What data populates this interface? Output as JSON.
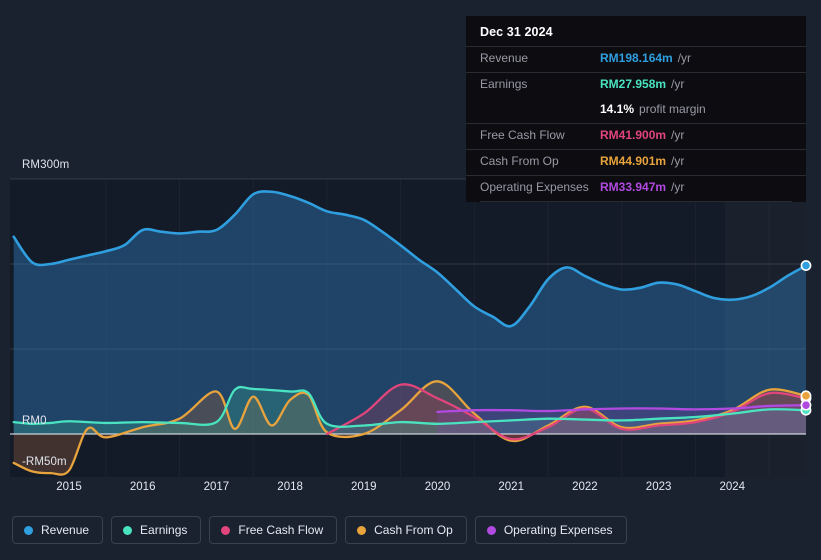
{
  "axis": {
    "y_labels": [
      {
        "text": "RM300m",
        "value": 300
      },
      {
        "text": "RM0",
        "value": 0
      },
      {
        "text": "-RM50m",
        "value": -50
      }
    ],
    "x_labels": [
      "2015",
      "2016",
      "2017",
      "2018",
      "2019",
      "2020",
      "2021",
      "2022",
      "2023",
      "2024"
    ],
    "currency": "RM",
    "unit": "m"
  },
  "tooltip": {
    "date": "Dec 31 2024",
    "rows": [
      {
        "label": "Revenue",
        "value": "RM198.164m",
        "unit": "/yr",
        "color": "#2f9fe0"
      },
      {
        "label": "Earnings",
        "value": "RM27.958m",
        "unit": "/yr",
        "color": "#4ae3c0"
      },
      {
        "label": "",
        "value": "14.1%",
        "unit": "profit margin",
        "color": "#ffffff"
      },
      {
        "label": "Free Cash Flow",
        "value": "RM41.900m",
        "unit": "/yr",
        "color": "#e0457b"
      },
      {
        "label": "Cash From Op",
        "value": "RM44.901m",
        "unit": "/yr",
        "color": "#e8a33d"
      },
      {
        "label": "Operating Expenses",
        "value": "RM33.947m",
        "unit": "/yr",
        "color": "#b14ae0"
      }
    ]
  },
  "legend": {
    "items": [
      {
        "label": "Revenue",
        "color": "#2f9fe0"
      },
      {
        "label": "Earnings",
        "color": "#4ae3c0"
      },
      {
        "label": "Free Cash Flow",
        "color": "#e0457b"
      },
      {
        "label": "Cash From Op",
        "color": "#e8a33d"
      },
      {
        "label": "Operating Expenses",
        "color": "#b14ae0"
      }
    ]
  },
  "chart_data": {
    "type": "area",
    "title": "",
    "xlabel": "",
    "ylabel": "RM",
    "ylim": [
      -50,
      300
    ],
    "xlim": [
      2014.2,
      2025.0
    ],
    "grid": true,
    "legend_position": "bottom",
    "gridlines": [
      300,
      200,
      100,
      0
    ],
    "zero_line": 0,
    "forecast_start": 2023.9,
    "series": [
      {
        "name": "Revenue",
        "color": "#2f9fe0",
        "fill": "rgba(47,120,180,0.45)",
        "x": [
          2014.25,
          2014.5,
          2014.75,
          2015.0,
          2015.25,
          2015.5,
          2015.75,
          2016.0,
          2016.25,
          2016.5,
          2016.75,
          2017.0,
          2017.25,
          2017.5,
          2017.75,
          2018.0,
          2018.25,
          2018.5,
          2018.75,
          2019.0,
          2019.25,
          2019.5,
          2019.75,
          2020.0,
          2020.25,
          2020.5,
          2020.75,
          2021.0,
          2021.25,
          2021.5,
          2021.75,
          2022.0,
          2022.25,
          2022.5,
          2022.75,
          2023.0,
          2023.25,
          2023.5,
          2023.75,
          2024.0,
          2024.25,
          2024.5,
          2024.75,
          2025.0
        ],
        "y": [
          232,
          202,
          200,
          205,
          210,
          215,
          222,
          240,
          238,
          236,
          238,
          240,
          258,
          282,
          285,
          280,
          272,
          262,
          258,
          252,
          238,
          222,
          205,
          190,
          170,
          150,
          138,
          127,
          150,
          182,
          196,
          186,
          176,
          170,
          172,
          178,
          176,
          168,
          160,
          158,
          162,
          172,
          186,
          198.164
        ]
      },
      {
        "name": "Earnings",
        "color": "#4ae3c0",
        "fill": "rgba(60,170,150,0.30)",
        "x": [
          2014.25,
          2014.5,
          2014.75,
          2015.0,
          2015.5,
          2016.0,
          2016.5,
          2017.0,
          2017.25,
          2017.5,
          2018.0,
          2018.25,
          2018.5,
          2019.0,
          2019.5,
          2020.0,
          2020.5,
          2021.0,
          2021.5,
          2022.0,
          2022.5,
          2023.0,
          2023.5,
          2024.0,
          2024.5,
          2025.0
        ],
        "y": [
          14,
          12,
          13,
          15,
          13,
          14,
          13,
          14,
          52,
          53,
          50,
          48,
          12,
          10,
          14,
          12,
          14,
          16,
          18,
          17,
          16,
          18,
          20,
          24,
          29,
          27.958
        ]
      },
      {
        "name": "Free Cash Flow",
        "color": "#e0457b",
        "fill": "rgba(170,60,90,0.30)",
        "x": [
          2018.5,
          2019.0,
          2019.5,
          2020.0,
          2020.5,
          2021.0,
          2021.5,
          2022.0,
          2022.5,
          2023.0,
          2023.5,
          2024.0,
          2024.5,
          2025.0
        ],
        "y": [
          0,
          24,
          58,
          42,
          20,
          -6,
          8,
          30,
          6,
          10,
          14,
          26,
          48,
          41.9
        ]
      },
      {
        "name": "Cash From Op",
        "color": "#e8a33d",
        "fill": "rgba(150,95,60,0.35)",
        "x": [
          2014.25,
          2014.5,
          2014.75,
          2015.0,
          2015.25,
          2015.5,
          2016.0,
          2016.5,
          2017.0,
          2017.25,
          2017.5,
          2017.75,
          2018.0,
          2018.25,
          2018.5,
          2019.0,
          2019.5,
          2020.0,
          2020.5,
          2021.0,
          2021.5,
          2022.0,
          2022.5,
          2023.0,
          2023.5,
          2024.0,
          2024.5,
          2025.0
        ],
        "y": [
          -34,
          -44,
          -46,
          -43,
          6,
          -4,
          8,
          18,
          50,
          6,
          44,
          10,
          40,
          46,
          2,
          0,
          28,
          62,
          24,
          -8,
          10,
          32,
          8,
          12,
          16,
          28,
          52,
          44.901
        ]
      },
      {
        "name": "Operating Expenses",
        "color": "#b14ae0",
        "fill": "rgba(130,70,170,0.30)",
        "x": [
          2020.0,
          2020.5,
          2021.0,
          2021.5,
          2022.0,
          2022.5,
          2023.0,
          2023.5,
          2024.0,
          2024.5,
          2025.0
        ],
        "y": [
          26,
          28,
          28,
          27,
          29,
          30,
          30,
          29,
          30,
          33,
          33.947
        ]
      }
    ]
  }
}
